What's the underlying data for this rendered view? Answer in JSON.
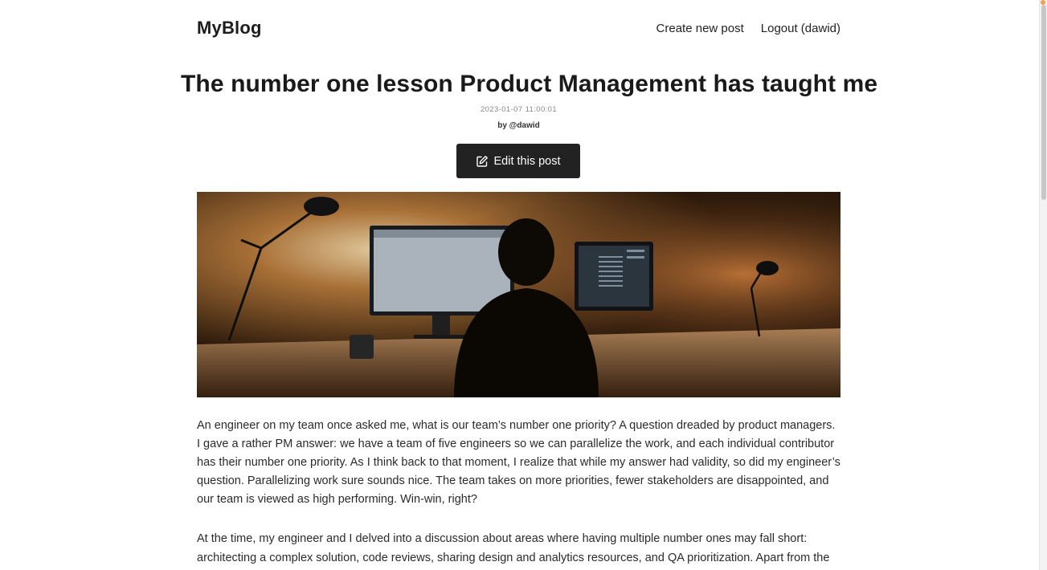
{
  "header": {
    "brand": "MyBlog",
    "nav": {
      "create_label": "Create new post",
      "logout_label": "Logout (dawid)"
    }
  },
  "post": {
    "title": "The number one lesson Product Management has taught me",
    "date": "2023-01-07 11:00:01",
    "author_prefix": "by",
    "author_handle": "@dawid",
    "edit_label": "Edit this post",
    "paragraphs": [
      "An engineer on my team once asked me, what is our team’s number one priority? A question dreaded by product managers. I gave a rather PM answer: we have a team of five engineers so we can parallelize the work, and each individual contributor has their number one priority. As I think back to that moment, I realize that while my answer had validity, so did my engineer’s question. Parallelizing work sure sounds nice. The team takes on more priorities, fewer stakeholders are disappointed, and our team is viewed as high performing. Win-win, right?",
      "At the time, my engineer and I delved into a discussion about areas where having multiple number ones may fall short: architecting a complex solution, code reviews, sharing design and analytics resources, and QA prioritization. Apart from the"
    ]
  },
  "icons": {
    "edit": "pencil-square-icon"
  },
  "colors": {
    "button_bg": "#222222",
    "button_text": "#ffffff",
    "text": "#2b2b2b"
  }
}
